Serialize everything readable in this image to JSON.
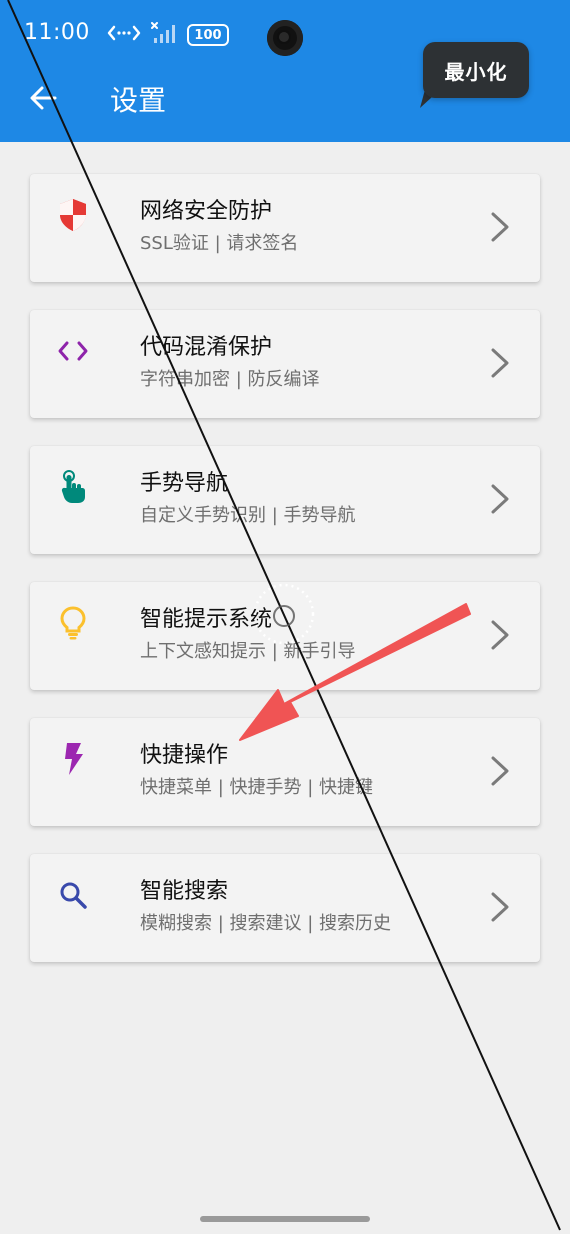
{
  "status_bar": {
    "time": "11:00",
    "battery": "100",
    "icons": [
      "data-transfer-icon",
      "no-signal-icon",
      "battery-icon"
    ]
  },
  "header": {
    "title": "设置",
    "back_icon": "arrow-left-icon",
    "background_color": "#1e88e5"
  },
  "tooltip": {
    "label": "最小化"
  },
  "settings": {
    "items": [
      {
        "title": "网络安全防护",
        "subtitle": "SSL验证 | 请求签名",
        "icon": "shield-icon",
        "icon_color": "#e53935"
      },
      {
        "title": "代码混淆保护",
        "subtitle": "字符串加密 | 防反编译",
        "icon": "code-icon",
        "icon_color": "#8e24aa"
      },
      {
        "title": "手势导航",
        "subtitle": "自定义手势识别 | 手势导航",
        "icon": "gesture-hand-icon",
        "icon_color": "#00897b"
      },
      {
        "title": "智能提示系统",
        "subtitle": "上下文感知提示 | 新手引导",
        "icon": "lightbulb-icon",
        "icon_color": "#fbc02d"
      },
      {
        "title": "快捷操作",
        "subtitle": "快捷菜单 | 快捷手势 | 快捷键",
        "icon": "flash-icon",
        "icon_color": "#9c27b0"
      },
      {
        "title": "智能搜索",
        "subtitle": "模糊搜索 | 搜索建议 | 搜索历史",
        "icon": "search-icon",
        "icon_color": "#3949ab"
      }
    ]
  },
  "annotation": {
    "arrow_color": "#f05454"
  }
}
